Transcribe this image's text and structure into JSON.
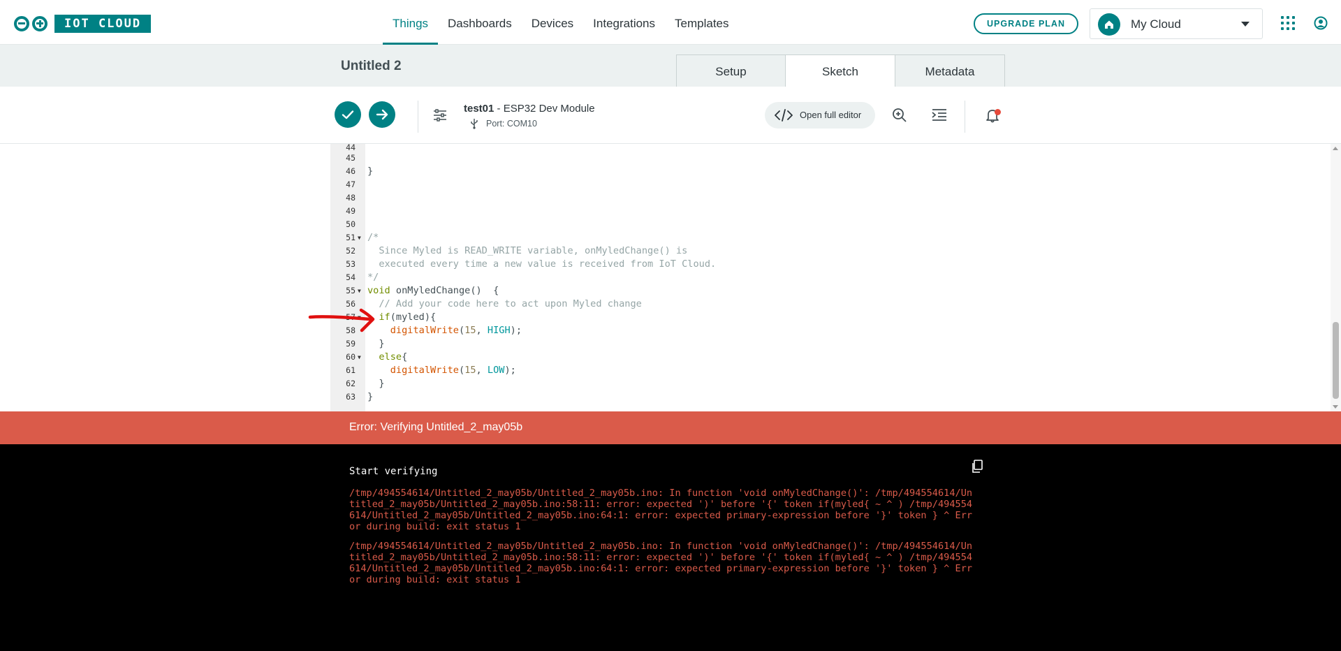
{
  "app": {
    "logo_text": "IOT CLOUD"
  },
  "nav": {
    "links": [
      "Things",
      "Dashboards",
      "Devices",
      "Integrations",
      "Templates"
    ],
    "upgrade_label": "UPGRADE PLAN",
    "cloud_label": "My Cloud",
    "accent": "#008184"
  },
  "thing": {
    "title": "Untitled 2",
    "tabs": [
      "Setup",
      "Sketch",
      "Metadata"
    ],
    "active_tab": "Sketch"
  },
  "toolbar": {
    "device_name": "test01",
    "device_separator": " - ",
    "board": "ESP32 Dev Module",
    "port": "Port: COM10",
    "open_editor_label": "Open full editor"
  },
  "editor": {
    "lines": [
      {
        "n": "44",
        "text": ""
      },
      {
        "n": "45",
        "text": ""
      },
      {
        "n": "46",
        "text": "}"
      },
      {
        "n": "47",
        "text": ""
      },
      {
        "n": "48",
        "text": ""
      },
      {
        "n": "49",
        "text": ""
      },
      {
        "n": "50",
        "text": ""
      },
      {
        "n": "51",
        "text": "/*"
      },
      {
        "n": "52",
        "text": "  Since Myled is READ_WRITE variable, onMyledChange() is"
      },
      {
        "n": "53",
        "text": "  executed every time a new value is received from IoT Cloud."
      },
      {
        "n": "54",
        "text": "*/"
      },
      {
        "n": "55",
        "text": "void onMyledChange()  {"
      },
      {
        "n": "56",
        "text": "  // Add your code here to act upon Myled change"
      },
      {
        "n": "57",
        "text": "  if(myled){"
      },
      {
        "n": "58",
        "text": "    digitalWrite(15, HIGH);"
      },
      {
        "n": "59",
        "text": "  }"
      },
      {
        "n": "60",
        "text": "  else{"
      },
      {
        "n": "61",
        "text": "    digitalWrite(15, LOW);"
      },
      {
        "n": "62",
        "text": "  }"
      },
      {
        "n": "63",
        "text": "}"
      }
    ]
  },
  "error": {
    "title": "Error: Verifying Untitled_2_may05b",
    "color": "#da5b4a"
  },
  "console": {
    "start": "Start verifying",
    "messages": [
      "/tmp/494554614/Untitled_2_may05b/Untitled_2_may05b.ino: In function 'void onMyledChange()': /tmp/494554614/Untitled_2_may05b/Untitled_2_may05b.ino:58:11: error: expected ')' before '{' token if(myled{ ~ ^ ) /tmp/494554614/Untitled_2_may05b/Untitled_2_may05b.ino:64:1: error: expected primary-expression before '}' token } ^ Error during build: exit status 1",
      "/tmp/494554614/Untitled_2_may05b/Untitled_2_may05b.ino: In function 'void onMyledChange()': /tmp/494554614/Untitled_2_may05b/Untitled_2_may05b.ino:58:11: error: expected ')' before '{' token if(myled{ ~ ^ ) /tmp/494554614/Untitled_2_may05b/Untitled_2_may05b.ino:64:1: error: expected primary-expression before '}' token } ^ Error during build: exit status 1"
    ]
  },
  "icons": {
    "verify": "checkmark-icon",
    "upload": "arrow-right-icon",
    "settings": "sliders-icon",
    "usb": "usb-icon",
    "code": "code-icon",
    "search": "search-icon",
    "indent": "indent-icon",
    "bell": "bell-icon",
    "copy": "copy-icon",
    "apps": "apps-grid-icon",
    "user": "user-icon",
    "home": "home-icon"
  }
}
